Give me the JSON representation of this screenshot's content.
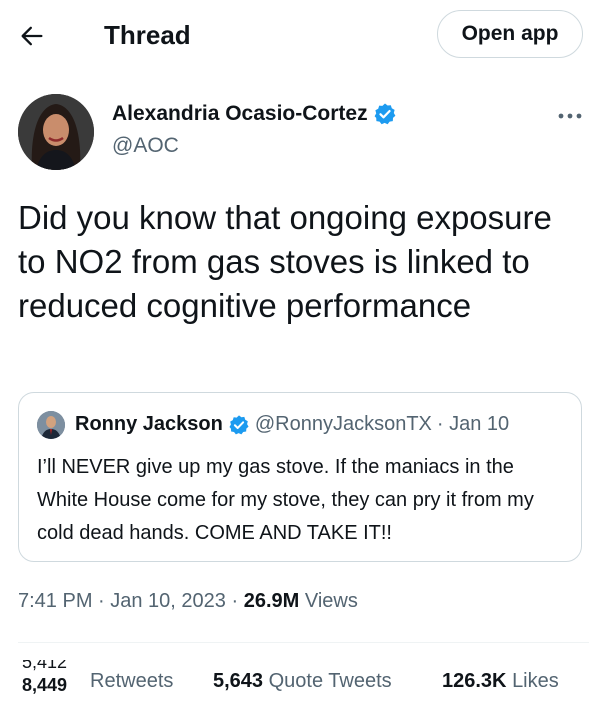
{
  "header": {
    "title": "Thread",
    "open_app_label": "Open app"
  },
  "author": {
    "name": "Alexandria Ocasio-Cortez",
    "handle": "@AOC",
    "verified": true
  },
  "tweet": {
    "text": "Did you know that ongoing exposure to NO2 from gas stoves is linked to reduced cognitive performance"
  },
  "quoted": {
    "name": "Ronny Jackson",
    "handle": "@RonnyJacksonTX",
    "date": "· Jan 10",
    "text": "I’ll NEVER give up my gas stove. If the maniacs in the White House come for my stove, they can pry it from my cold dead hands. COME AND TAKE IT!!"
  },
  "meta": {
    "time": "7:41 PM · Jan 10, 2023 ·",
    "views_count": "26.9M",
    "views_label": "Views"
  },
  "stats": {
    "partial_top": "5,412",
    "retweets_count": "8,449",
    "retweets_label": "Retweets",
    "quotes_count": "5,643",
    "quotes_label": "Quote Tweets",
    "likes_count": "126.3K",
    "likes_label": "Likes"
  },
  "colors": {
    "verified_blue": "#1d9bf0",
    "secondary_text": "#536471",
    "border": "#cfd9de"
  },
  "icons": {
    "back": "arrow-left-icon",
    "more": "more-horizontal-icon",
    "verified": "verified-badge-icon"
  }
}
